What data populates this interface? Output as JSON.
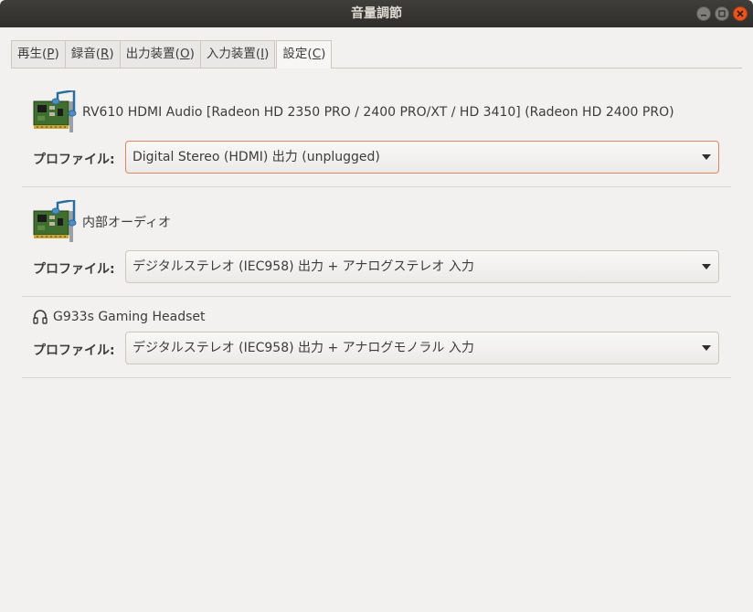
{
  "window": {
    "title": "音量調節"
  },
  "tabs": [
    {
      "label": "再生(",
      "key": "P",
      "end": ")"
    },
    {
      "label": "録音(",
      "key": "R",
      "end": ")"
    },
    {
      "label": "出力装置(",
      "key": "O",
      "end": ")"
    },
    {
      "label": "入力装置(",
      "key": "I",
      "end": ")"
    },
    {
      "label": "設定(",
      "key": "C",
      "end": ")"
    }
  ],
  "devices": [
    {
      "name": "RV610 HDMI Audio [Radeon HD 2350 PRO / 2400 PRO/XT / HD 3410] (Radeon HD 2400 PRO)",
      "icon": "sound-card-icon",
      "profile_label": "プロファイル:",
      "profile_value": "Digital Stereo (HDMI) 出力 (unplugged)"
    },
    {
      "name": "内部オーディオ",
      "icon": "sound-card-icon",
      "profile_label": "プロファイル:",
      "profile_value": "デジタルステレオ (IEC958) 出力 + アナログステレオ 入力"
    },
    {
      "name": "G933s Gaming Headset",
      "icon": "headset-icon",
      "profile_label": "プロファイル:",
      "profile_value": "デジタルステレオ (IEC958) 出力 + アナログモノラル 入力"
    }
  ],
  "colors": {
    "titlebar": "#2f2e2b",
    "accent": "#e95420",
    "focus": "#e0885d"
  }
}
